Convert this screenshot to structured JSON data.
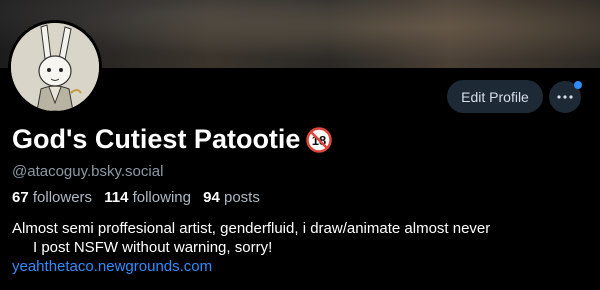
{
  "profile": {
    "display_name": "God's Cutiest Patootie",
    "age_badge_text": "18",
    "handle": "@atacoguy.bsky.social",
    "followers_count": "67",
    "followers_label": "followers",
    "following_count": "114",
    "following_label": "following",
    "posts_count": "94",
    "posts_label": "posts",
    "bio_line1": "Almost semi proffesional artist, genderfluid, i draw/animate almost never",
    "bio_line2": "I post NSFW without warning, sorry!",
    "bio_link": "yeahthetaco.newgrounds.com"
  },
  "actions": {
    "edit_label": "Edit Profile",
    "more_icon": "ellipsis-icon"
  },
  "colors": {
    "background": "#000000",
    "button_bg": "#1e2936",
    "link": "#2f8cff",
    "badge_red": "#e0443a"
  }
}
